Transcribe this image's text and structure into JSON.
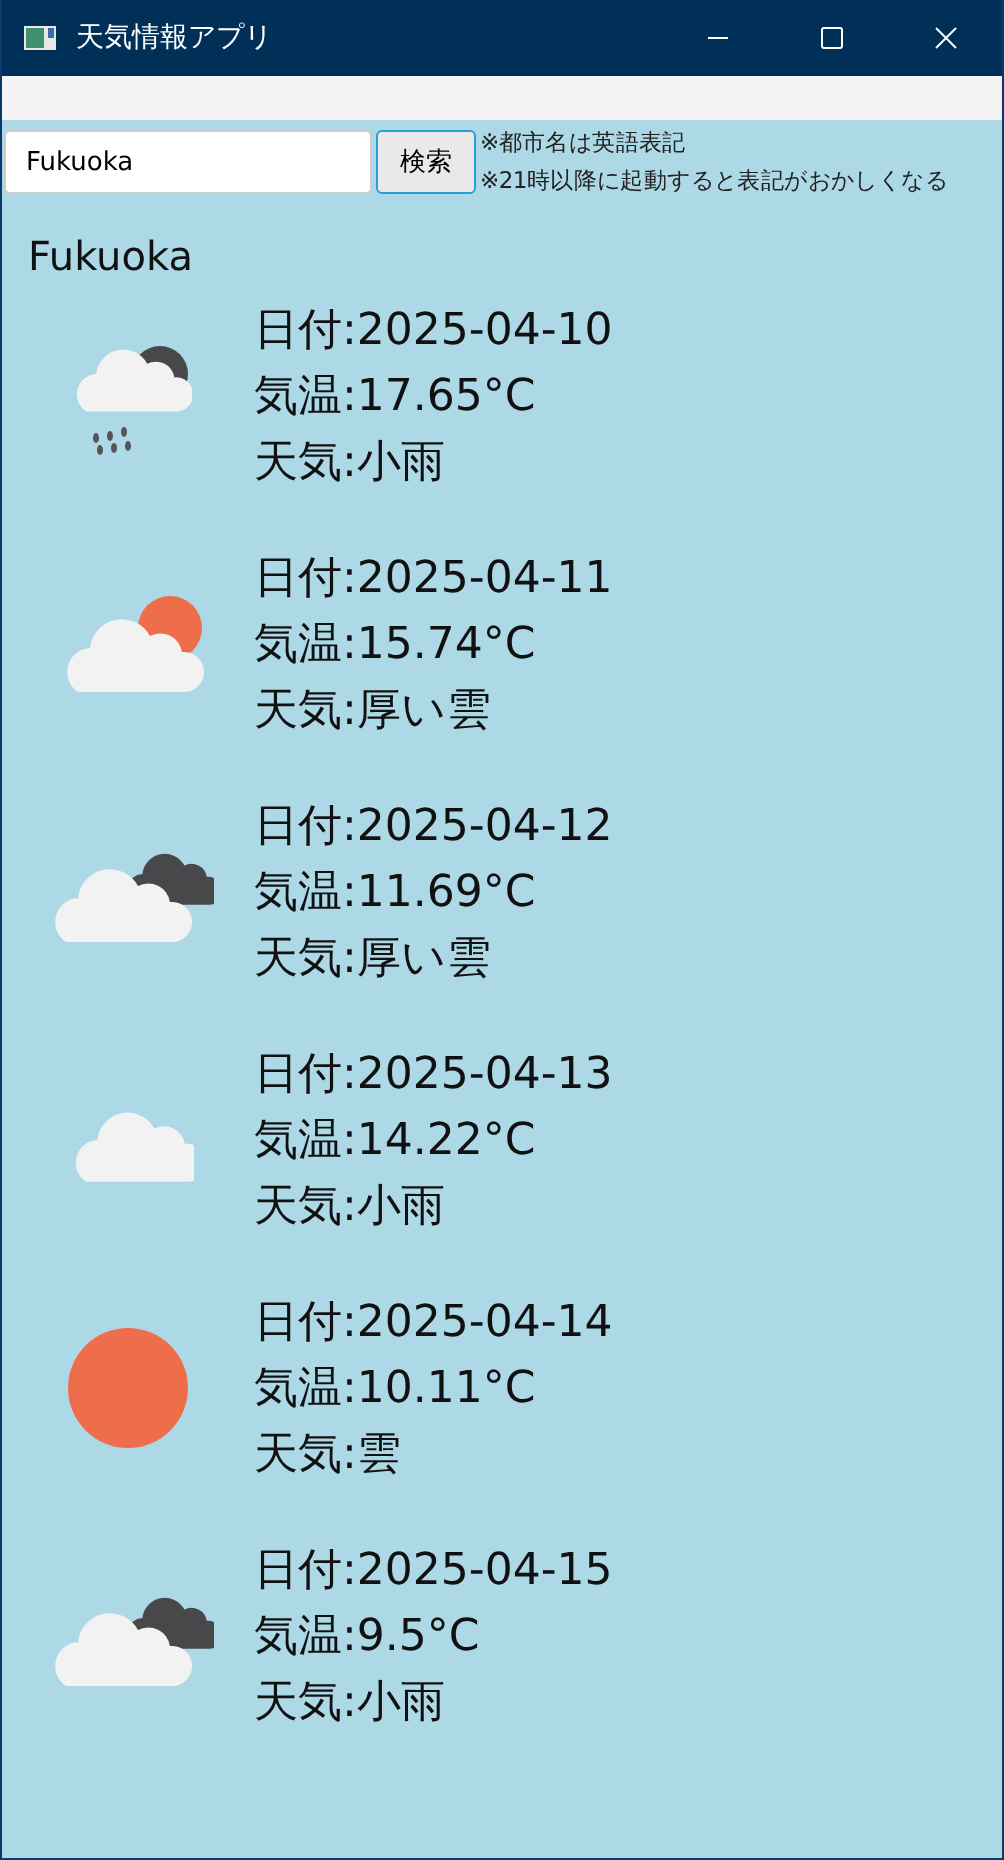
{
  "window": {
    "title": "天気情報アプリ"
  },
  "search": {
    "value": "Fukuoka",
    "button": "検索"
  },
  "notes": [
    "※都市名は英語表記",
    "※21時以降に起動すると表記がおかしくなる"
  ],
  "city": "Fukuoka",
  "days": [
    {
      "kind": "rain",
      "date": "日付:2025-04-10",
      "temp": "気温:17.65°C",
      "weather": "天気:小雨"
    },
    {
      "kind": "partly",
      "date": "日付:2025-04-11",
      "temp": "気温:15.74°C",
      "weather": "天気:厚い雲"
    },
    {
      "kind": "overcast",
      "date": "日付:2025-04-12",
      "temp": "気温:11.69°C",
      "weather": "天気:厚い雲"
    },
    {
      "kind": "cloud",
      "date": "日付:2025-04-13",
      "temp": "気温:14.22°C",
      "weather": "天気:小雨"
    },
    {
      "kind": "sun",
      "date": "日付:2025-04-14",
      "temp": "気温:10.11°C",
      "weather": "天気:雲"
    },
    {
      "kind": "overcast",
      "date": "日付:2025-04-15",
      "temp": "気温:9.5°C",
      "weather": "天気:小雨"
    }
  ]
}
